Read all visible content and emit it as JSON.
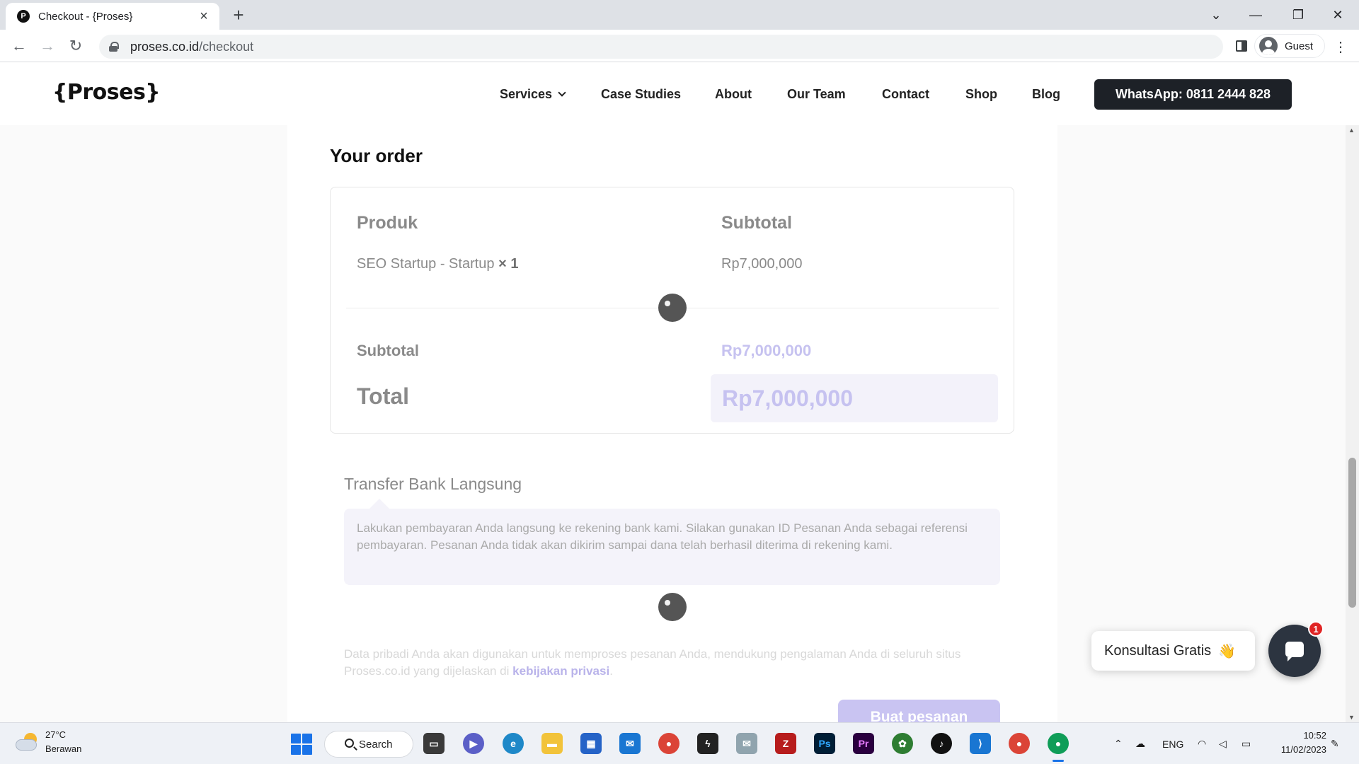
{
  "browser": {
    "tab_title": "Checkout - {Proses}",
    "favicon_letter": "P",
    "url_host": "proses.co.id",
    "url_path": "/checkout",
    "profile_name": "Guest"
  },
  "site": {
    "logo": "{Proses}",
    "nav": [
      "Services",
      "Case Studies",
      "About",
      "Our Team",
      "Contact",
      "Shop",
      "Blog"
    ],
    "whatsapp_button": "WhatsApp: 0811 2444 828"
  },
  "order": {
    "heading": "Your order",
    "col_product": "Produk",
    "col_subtotal": "Subtotal",
    "item_name": "SEO Startup - Startup",
    "item_qty": "× 1",
    "item_price": "Rp7,000,000",
    "subtotal_label": "Subtotal",
    "subtotal_value": "Rp7,000,000",
    "total_label": "Total",
    "total_value": "Rp7,000,000"
  },
  "payment": {
    "method": "Transfer Bank Langsung",
    "description": "Lakukan pembayaran Anda langsung ke rekening bank kami. Silakan gunakan ID Pesanan Anda sebagai referensi pembayaran. Pesanan Anda tidak akan dikirim sampai dana telah berhasil diterima di rekening kami."
  },
  "privacy": {
    "text": "Data pribadi Anda akan digunakan untuk memproses pesanan Anda, mendukung pengalaman Anda di seluruh situs Proses.co.id yang dijelaskan di",
    "link": "kebijakan privasi",
    "suffix": "."
  },
  "place_order_button": "Buat pesanan",
  "chat": {
    "consult_label": "Konsultasi Gratis",
    "consult_emoji": "👋",
    "badge_count": "1"
  },
  "taskbar": {
    "temperature": "27°C",
    "weather": "Berawan",
    "search_label": "Search",
    "language": "ENG",
    "time": "10:52",
    "date": "11/02/2023"
  },
  "colors": {
    "accent_light": "#c6c2f0",
    "button_dark": "#1d2127",
    "chat_badge": "#e02424"
  }
}
